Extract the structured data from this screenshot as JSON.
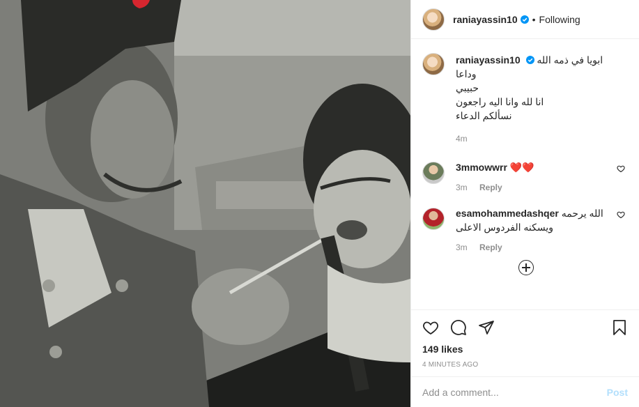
{
  "post": {
    "username": "raniayassin10",
    "follow_status": "Following",
    "dot": "•"
  },
  "caption": {
    "username": "raniayassin10",
    "lines": [
      "ابويا في ذمه الله وداعا",
      "حبيبي",
      "انا لله وانا اليه راجعون",
      "نسألكم الدعاء"
    ],
    "time": "4m"
  },
  "comments": [
    {
      "username": "3mmowwrr",
      "text": "❤️❤️",
      "time": "3m",
      "reply_label": "Reply"
    },
    {
      "username": "esamohammedashqer",
      "text_line1": "الله يرحمه",
      "text_line2": "ويسكنه الفردوس الاعلى",
      "time": "3m",
      "reply_label": "Reply"
    }
  ],
  "actions": {
    "likes": "149 likes",
    "timestamp": "4 MINUTES AGO"
  },
  "add_comment": {
    "placeholder": "Add a comment...",
    "post_label": "Post"
  },
  "colors": {
    "verified": "#0095f6",
    "heart_red": "#ed4956",
    "post_disabled": "#b2dffc"
  },
  "icons": [
    "verified-badge-icon",
    "heart-icon",
    "comment-icon",
    "share-icon",
    "bookmark-icon",
    "load-more-icon"
  ]
}
